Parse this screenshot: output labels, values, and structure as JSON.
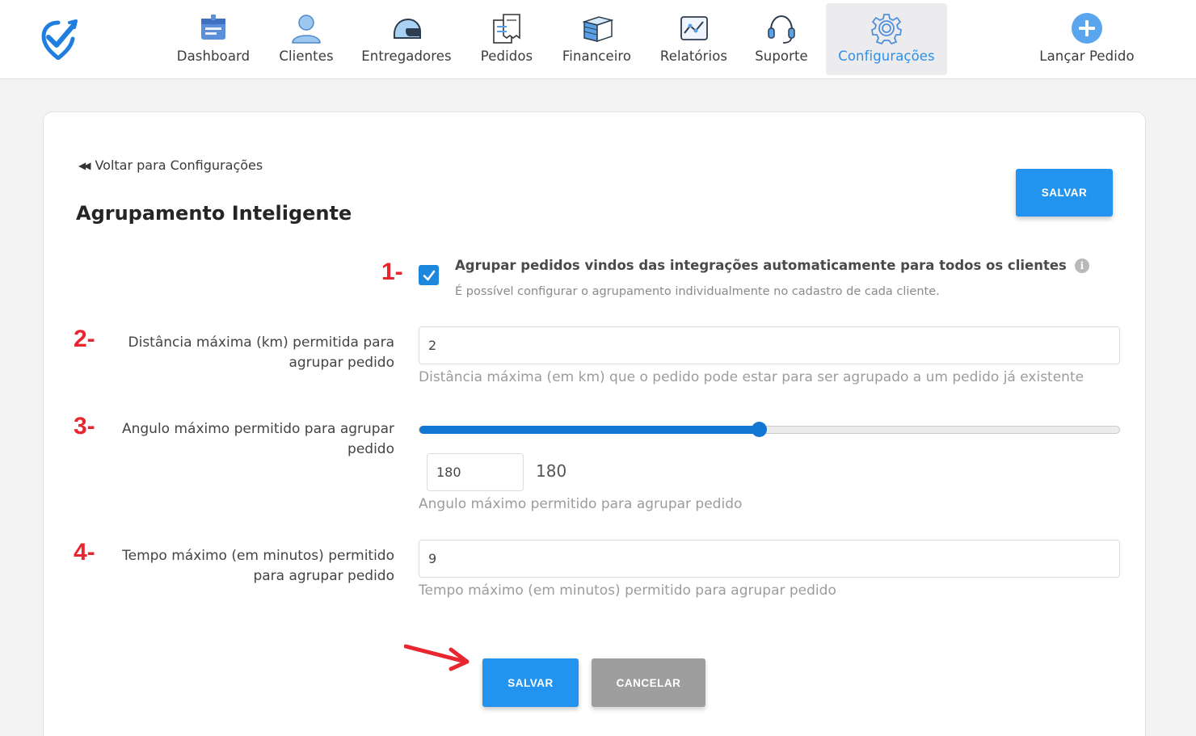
{
  "nav": {
    "items": [
      {
        "label": "Dashboard",
        "icon": "dashboard-icon"
      },
      {
        "label": "Clientes",
        "icon": "user-icon"
      },
      {
        "label": "Entregadores",
        "icon": "helmet-icon"
      },
      {
        "label": "Pedidos",
        "icon": "receipt-icon"
      },
      {
        "label": "Financeiro",
        "icon": "money-stack-icon"
      },
      {
        "label": "Relatórios",
        "icon": "chart-icon"
      },
      {
        "label": "Suporte",
        "icon": "headset-icon"
      },
      {
        "label": "Configurações",
        "icon": "gear-icon",
        "active": true
      }
    ],
    "launch_label": "Lançar Pedido",
    "accent": "#2e8fe8"
  },
  "page": {
    "back_label": "Voltar para Configurações",
    "title": "Agrupamento Inteligente",
    "save_label": "SALVAR",
    "cancel_label": "CANCELAR"
  },
  "markers": [
    "1-",
    "2-",
    "3-",
    "4-"
  ],
  "fields": {
    "auto_group": {
      "checked": true,
      "label": "Agrupar pedidos vindos das integrações automaticamente para todos os clientes",
      "help": "É possível configurar o agrupamento individualmente no cadastro de cada cliente."
    },
    "max_distance": {
      "label_line1": "Distância máxima (km) permitida para",
      "label_line2": "agrupar pedido",
      "value": "2",
      "help": "Distância máxima (em km) que o pedido pode estar para ser agrupado a um pedido já existente"
    },
    "max_angle": {
      "label_line1": "Angulo máximo permitido para agrupar",
      "label_line2": "pedido",
      "value": "180",
      "display_value": "180",
      "slider_fraction": 0.485,
      "help": "Angulo máximo permitido para agrupar pedido"
    },
    "max_time": {
      "label_line1": "Tempo máximo (em minutos) permitido",
      "label_line2": "para agrupar pedido",
      "value": "9",
      "help": "Tempo máximo (em minutos) permitido para agrupar pedido"
    }
  },
  "colors": {
    "primary": "#2294ef",
    "secondary": "#9e9e9e",
    "marker": "#e8262f"
  }
}
